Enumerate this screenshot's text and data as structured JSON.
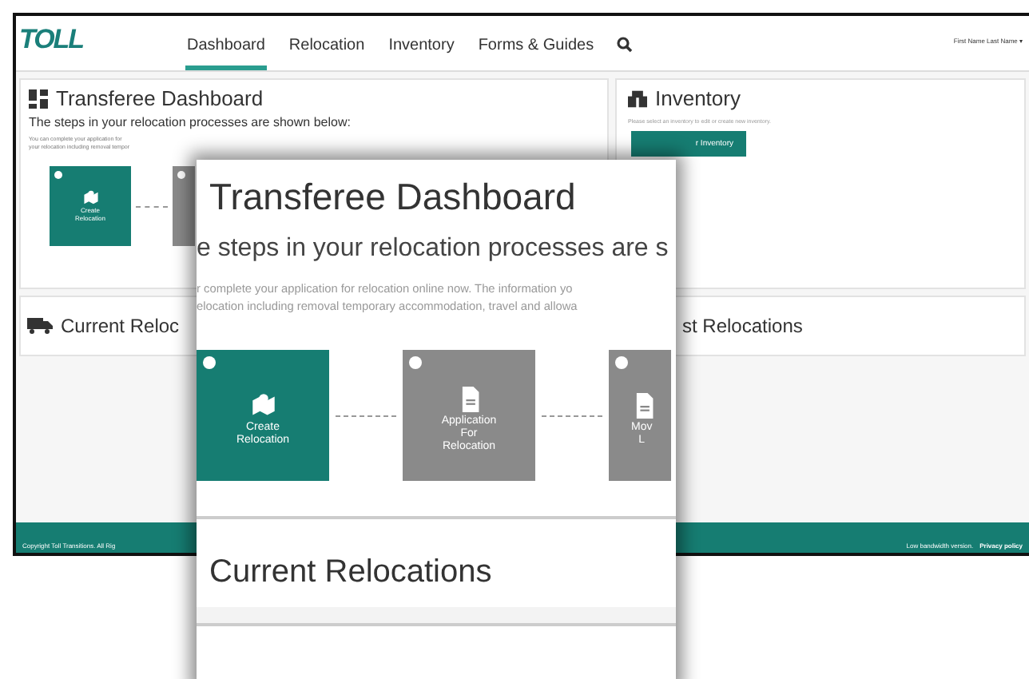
{
  "header": {
    "logo": "TOLL",
    "nav": [
      {
        "label": "Dashboard",
        "selected": true
      },
      {
        "label": "Relocation",
        "selected": false
      },
      {
        "label": "Inventory",
        "selected": false
      },
      {
        "label": "Forms & Guides",
        "selected": false
      }
    ],
    "user_menu": "First Name Last Name ▾"
  },
  "dashboard_panel": {
    "title": "Transferee Dashboard",
    "subtitle": "The steps in your relocation processes are shown below:",
    "intro": [
      "You can complete your application for",
      "your relocation including removal tempor"
    ],
    "steps": [
      {
        "lines": [
          "Create",
          "Relocation"
        ],
        "kind": "create",
        "current": true
      },
      {
        "kind": "blank",
        "current": false
      }
    ]
  },
  "inventory_panel": {
    "title": "Inventory",
    "hint": "Please select an inventory to edit or create new inventory.",
    "button": "r Inventory"
  },
  "current_relocations": {
    "title": "Current Reloc"
  },
  "past_relocations": {
    "title": "st Relocations"
  },
  "footer": {
    "copyright": "Copyright Toll Transitions. All Rig",
    "links": [
      "Low bandwidth version.",
      "Privacy policy"
    ]
  },
  "zoom_inset": {
    "title": "Transferee Dashboard",
    "subtitle": "e steps in your relocation processes are s",
    "intro": [
      "r complete your application for relocation online now. The information yo",
      "elocation including removal temporary accommodation, travel and allowa"
    ],
    "steps": [
      {
        "lines": [
          "Create",
          "Relocation"
        ],
        "kind": "create",
        "current": true
      },
      {
        "lines": [
          "Application",
          "For",
          "Relocation"
        ],
        "kind": "form",
        "current": false
      },
      {
        "lines": [
          "Mov",
          "L"
        ],
        "kind": "form",
        "current": false
      }
    ],
    "section": "Current Relocations"
  }
}
